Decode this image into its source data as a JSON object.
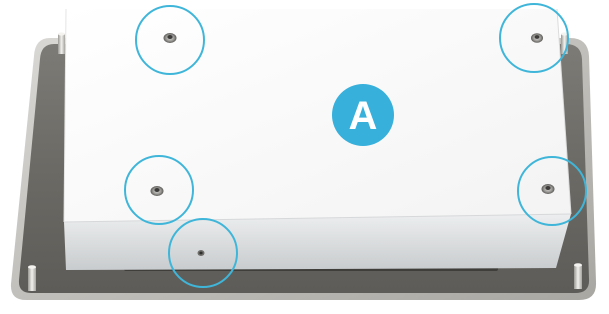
{
  "figure": {
    "callout_label": "A",
    "highlight_color": "#3fb6d9",
    "badge_color": "#37b0dc",
    "badge_text_color": "#ffffff",
    "highlighted_fasteners": [
      "fastener-top-left",
      "fastener-top-right",
      "fastener-middle-left",
      "fastener-middle-right",
      "fastener-bottom-front"
    ]
  }
}
